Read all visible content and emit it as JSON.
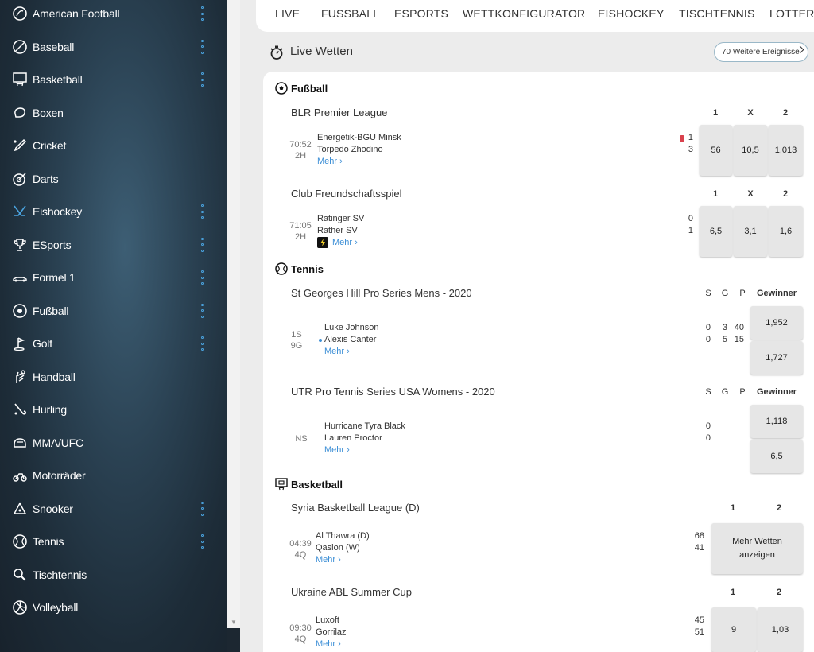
{
  "sidebar": {
    "items": [
      {
        "label": "American Football",
        "icon": "american-football-icon",
        "menu": true
      },
      {
        "label": "Baseball",
        "icon": "baseball-icon",
        "menu": true
      },
      {
        "label": "Basketball",
        "icon": "basketball-icon",
        "menu": true
      },
      {
        "label": "Boxen",
        "icon": "boxing-icon",
        "menu": false
      },
      {
        "label": "Cricket",
        "icon": "cricket-icon",
        "menu": false
      },
      {
        "label": "Darts",
        "icon": "darts-icon",
        "menu": false
      },
      {
        "label": "Eishockey",
        "icon": "ice-hockey-icon",
        "menu": true
      },
      {
        "label": "ESports",
        "icon": "esports-trophy-icon",
        "menu": true
      },
      {
        "label": "Formel 1",
        "icon": "formula1-icon",
        "menu": true
      },
      {
        "label": "Fußball",
        "icon": "football-icon",
        "menu": true
      },
      {
        "label": "Golf",
        "icon": "golf-icon",
        "menu": true
      },
      {
        "label": "Handball",
        "icon": "handball-icon",
        "menu": false
      },
      {
        "label": "Hurling",
        "icon": "hurling-icon",
        "menu": false
      },
      {
        "label": "MMA/UFC",
        "icon": "mma-icon",
        "menu": false
      },
      {
        "label": "Motorräder",
        "icon": "motorbike-icon",
        "menu": false
      },
      {
        "label": "Snooker",
        "icon": "snooker-icon",
        "menu": true
      },
      {
        "label": "Tennis",
        "icon": "tennis-icon",
        "menu": true
      },
      {
        "label": "Tischtennis",
        "icon": "table-tennis-icon",
        "menu": false
      },
      {
        "label": "Volleyball",
        "icon": "volleyball-icon",
        "menu": false
      }
    ]
  },
  "nav": {
    "tabs": [
      "LIVE",
      "FUSSBALL",
      "ESPORTS",
      "WETTKONFIGURATOR",
      "EISHOCKEY",
      "TISCHTENNIS",
      "LOTTERIE"
    ]
  },
  "live": {
    "title": "Live Wetten",
    "more_events": "70 Weitere Ereignisse"
  },
  "sections": {
    "fussball": {
      "title": "Fußball",
      "leagues": [
        {
          "name": "BLR Premier League",
          "cols": [
            "1",
            "X",
            "2"
          ],
          "clock": "70:52",
          "period": "2H",
          "home": "Energetik-BGU Minsk",
          "away": "Torpedo Zhodino",
          "home_score": "1",
          "away_score": "3",
          "odds": [
            "56",
            "10,5",
            "1,013"
          ],
          "mehr": "Mehr"
        },
        {
          "name": "Club Freundschaftsspiel",
          "cols": [
            "1",
            "X",
            "2"
          ],
          "clock": "71:05",
          "period": "2H",
          "home": "Ratinger SV",
          "away": "Rather SV",
          "home_score": "0",
          "away_score": "1",
          "odds": [
            "6,5",
            "3,1",
            "1,6"
          ],
          "mehr": "Mehr"
        }
      ]
    },
    "tennis": {
      "title": "Tennis",
      "leagues": [
        {
          "name": "St Georges Hill Pro Series Mens - 2020",
          "cols": [
            "S",
            "G",
            "P",
            "Gewinner"
          ],
          "clock": "1S",
          "period": "9G",
          "home": "Luke Johnson",
          "away": "Alexis Canter",
          "home_s": "0",
          "home_g": "3",
          "home_p": "40",
          "away_s": "0",
          "away_g": "5",
          "away_p": "15",
          "odds": [
            "1,952",
            "1,727"
          ],
          "mehr": "Mehr"
        },
        {
          "name": "UTR Pro Tennis Series USA Womens - 2020",
          "cols": [
            "S",
            "G",
            "P",
            "Gewinner"
          ],
          "clock": "NS",
          "period": "",
          "home": "Hurricane Tyra Black",
          "away": "Lauren Proctor",
          "home_s": "0",
          "away_s": "0",
          "odds": [
            "1,118",
            "6,5"
          ],
          "mehr": "Mehr"
        }
      ]
    },
    "basketball": {
      "title": "Basketball",
      "leagues": [
        {
          "name": "Syria Basketball League (D)",
          "cols": [
            "1",
            "2"
          ],
          "clock": "04:39",
          "period": "4Q",
          "home": "Al Thawra (D)",
          "away": "Qasion (W)",
          "home_score": "68",
          "away_score": "41",
          "more_bets": "Mehr Wetten anzeigen",
          "mehr": "Mehr"
        },
        {
          "name": "Ukraine ABL Summer Cup",
          "cols": [
            "1",
            "2"
          ],
          "clock": "09:30",
          "period": "4Q",
          "home": "Luxoft",
          "away": "Gorrilaz",
          "home_score": "45",
          "away_score": "51",
          "odds": [
            "9",
            "1,03"
          ],
          "mehr": "Mehr"
        }
      ]
    }
  },
  "colors": {
    "accent": "#3d8fd6",
    "sidebar_bg": "#1d2c38",
    "odds_bg": "#e6e6e6",
    "red_card": "#d9414d"
  }
}
